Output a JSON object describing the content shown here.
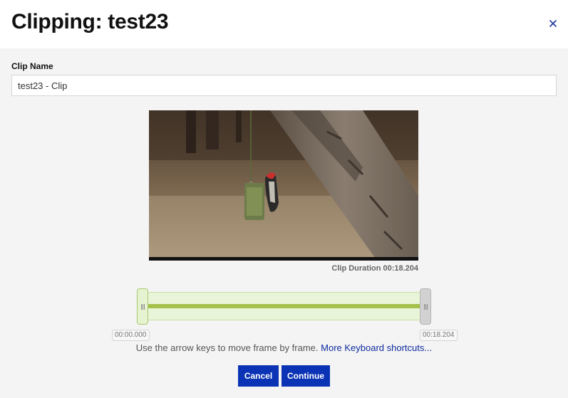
{
  "dialog": {
    "title": "Clipping: test23",
    "close_icon": "close-icon"
  },
  "form": {
    "clip_name_label": "Clip Name",
    "clip_name_value": "test23 - Clip"
  },
  "video": {
    "description_icon": "video-preview"
  },
  "clip": {
    "duration_label": "Clip Duration",
    "duration_value": "00:18.204",
    "start_time": "00:00.000",
    "end_time": "00:18.204",
    "selection_start_fraction": 0,
    "selection_end_fraction": 1
  },
  "hint": {
    "text": "Use the arrow keys to move frame by frame.",
    "link": "More Keyboard shortcuts..."
  },
  "actions": {
    "cancel_label": "Cancel",
    "continue_label": "Continue"
  },
  "colors": {
    "primary": "#0b33b5",
    "selection": "#a4c24a",
    "link": "#0d2a9e"
  }
}
